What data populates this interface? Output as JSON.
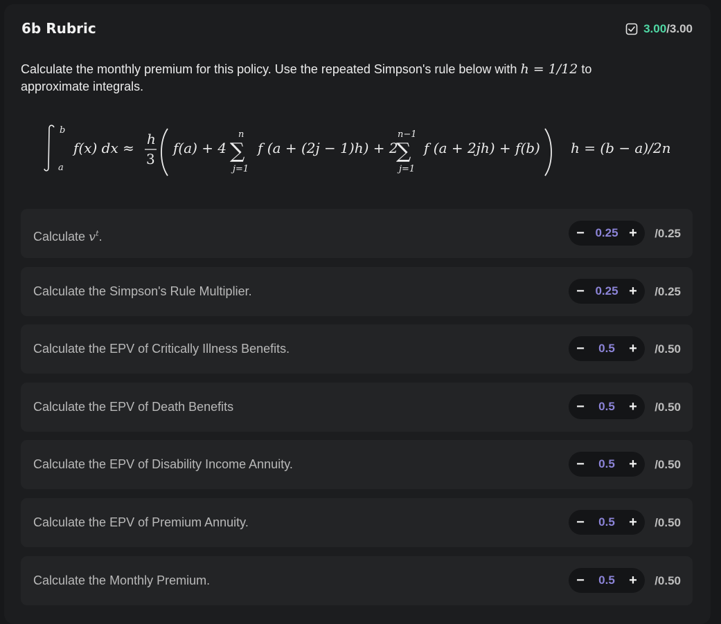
{
  "header": {
    "title": "6b Rubric",
    "score_earned": "3.00",
    "score_total": "/3.00",
    "accent_color": "#4fd8a4"
  },
  "description": {
    "before": "Calculate the monthly premium for this policy. Use the repeated Simpson's rule below with ",
    "math": "h = 1/12",
    "after": " to approximate integrals."
  },
  "formula": {
    "lhs": "∫ f(x) dx ≈ (h/3) ( f(a) + 4 Σ f(a + (2j − 1)h) + 2 Σ f(a + 2jh) + f(b) )",
    "rhs": "h = (b − a)/2n"
  },
  "rubric": {
    "items": [
      {
        "label": "Calculate ",
        "math": "vt",
        "suffix": ".",
        "value": "0.25",
        "max": "/0.25"
      },
      {
        "label": "Calculate the Simpson's Rule Multiplier.",
        "value": "0.25",
        "max": "/0.25"
      },
      {
        "label": "Calculate the EPV of Critically Illness Benefits.",
        "value": "0.5",
        "max": "/0.50"
      },
      {
        "label": "Calculate the EPV of Death Benefits",
        "value": "0.5",
        "max": "/0.50"
      },
      {
        "label": "Calculate the EPV of Disability Income Annuity.",
        "value": "0.5",
        "max": "/0.50"
      },
      {
        "label": "Calculate the EPV of Premium Annuity.",
        "value": "0.5",
        "max": "/0.50"
      },
      {
        "label": "Calculate the Monthly Premium.",
        "value": "0.5",
        "max": "/0.50"
      }
    ],
    "minus_label": "−",
    "plus_label": "+",
    "value_color": "#8c84d8"
  },
  "icons": {
    "score_icon": "checkbox-check-icon"
  }
}
